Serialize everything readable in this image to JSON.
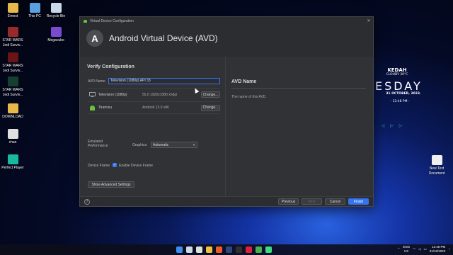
{
  "desktop": {
    "icons_left": [
      {
        "label": "Ernest",
        "icon": "folder-user-icon",
        "color": "#e8b84a"
      },
      {
        "label": "STAR WARS\nJedi Surviv...",
        "icon": "game-icon",
        "color": "#9a2a2a"
      },
      {
        "label": "STAR WARS\nJedi Surviv...",
        "icon": "game-icon",
        "color": "#6a1515"
      },
      {
        "label": "STAR WARS\nJedi Surviv...",
        "icon": "game-icon",
        "color": "#154030"
      },
      {
        "label": "DOWNLOAD",
        "icon": "folder-icon",
        "color": "#e8b84a"
      },
      {
        "label": "chan",
        "icon": "file-icon",
        "color": "#e0e0e0"
      },
      {
        "label": "Perfect Player",
        "icon": "player-icon",
        "color": "#1ab8a0"
      }
    ],
    "icons_top": [
      {
        "label": "This PC",
        "icon": "computer-icon",
        "color": "#5aa0e0"
      },
      {
        "label": "Recycle Bin",
        "icon": "recycle-bin-icon",
        "color": "#c8d8e8"
      },
      {
        "label": "Megacubo",
        "icon": "megacubo-icon",
        "color": "#7a4ad0"
      }
    ],
    "icon_right": {
      "label": "New Text\nDocument",
      "icon": "text-document-icon",
      "color": "#f0f0f0"
    }
  },
  "widget": {
    "location": "KEDAH",
    "weather": "CLOUDY 30°C",
    "day": "ESDAY",
    "date": "31 OCTOBER, 2023.",
    "time": "- 12:48 PM -"
  },
  "dialog": {
    "window_title": "Virtual Device Configuration",
    "header_title": "Android Virtual Device (AVD)",
    "section_title": "Verify Configuration",
    "avd_name_label": "AVD Name",
    "avd_name_value": "Television (1080p) API 33",
    "device_rows": [
      {
        "name": "Television (1080p)",
        "spec": "55.0 1920x1080 xhdpi",
        "button": "Change...",
        "icon": "tv-icon"
      },
      {
        "name": "Tiramisu",
        "spec": "Android 13.0 x86",
        "button": "Change...",
        "icon": "android-icon"
      }
    ],
    "emulated_performance_label": "Emulated\nPerformance",
    "graphics_label": "Graphics:",
    "graphics_value": "Automatic",
    "device_frame_label": "Device Frame",
    "enable_device_frame_label": "Enable Device Frame",
    "enable_device_frame_checked": true,
    "show_advanced_label": "Show Advanced Settings",
    "right_title": "AVD Name",
    "right_description": "The name of this AVD.",
    "help_label": "?",
    "footer_buttons": {
      "previous": "Previous",
      "next": "Next",
      "cancel": "Cancel",
      "finish": "Finish"
    },
    "accent_color": "#3574f0"
  },
  "taskbar": {
    "apps": [
      {
        "icon": "windows-start-icon",
        "color": "#3a8ff0"
      },
      {
        "icon": "search-icon",
        "color": "#cfd8e8"
      },
      {
        "icon": "task-view-icon",
        "color": "#e0e0e0"
      },
      {
        "icon": "file-explorer-icon",
        "color": "#f0c040"
      },
      {
        "icon": "brave-browser-icon",
        "color": "#f05a28"
      },
      {
        "icon": "steam-icon",
        "color": "#2a4a7a"
      },
      {
        "icon": "terminal-icon",
        "color": "#303030"
      },
      {
        "icon": "opera-gx-icon",
        "color": "#e0203a"
      },
      {
        "icon": "chrome-icon",
        "color": "#4caf50"
      },
      {
        "icon": "android-studio-icon",
        "color": "#3ddc84"
      }
    ],
    "lang": "ENG",
    "region": "US",
    "time": "12:48 PM",
    "date": "31/10/2023"
  }
}
